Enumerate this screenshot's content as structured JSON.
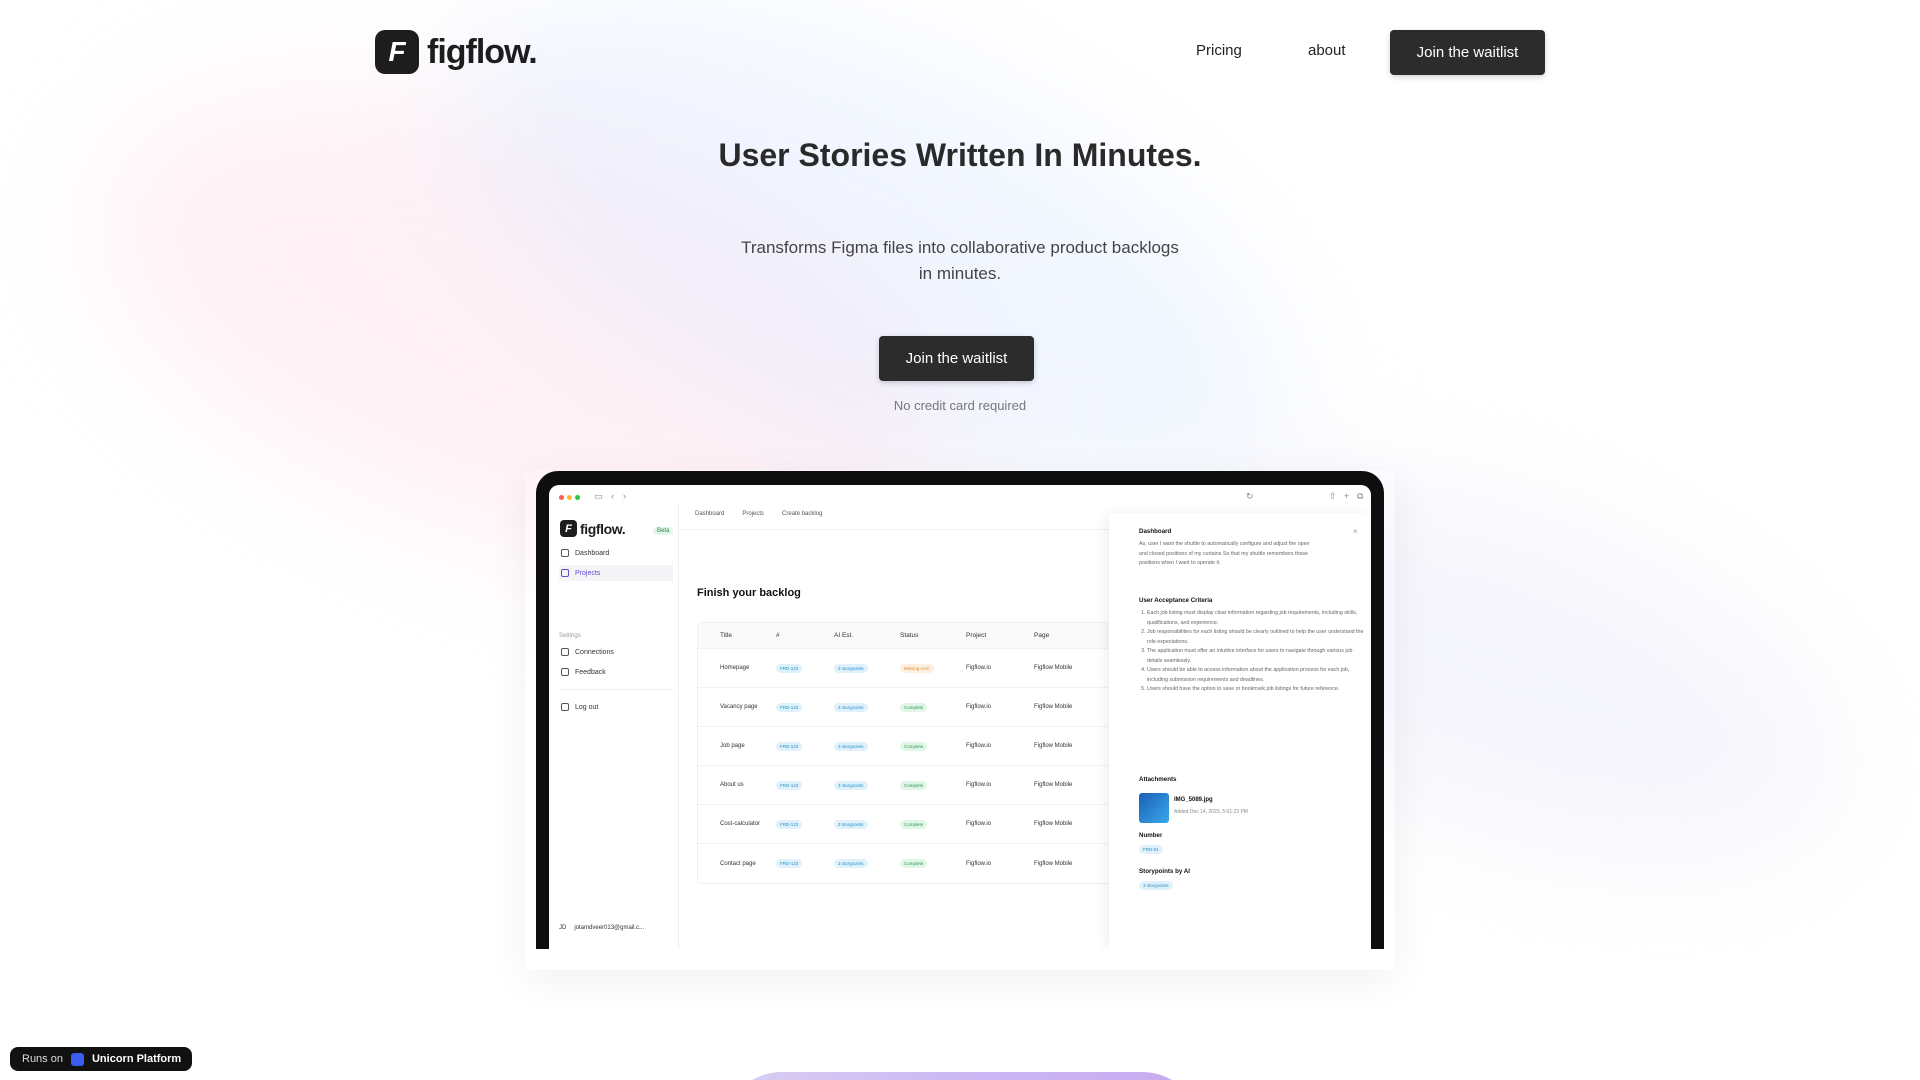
{
  "nav": {
    "logo_text": "figflow.",
    "logo_letter": "F",
    "links": [
      "Pricing",
      "about"
    ],
    "cta": "Join the waitlist"
  },
  "hero": {
    "title": "User Stories Written In Minutes.",
    "subtitle": "Transforms Figma files into collaborative product backlogs in minutes.",
    "cta": "Join the waitlist",
    "note": "No credit card required"
  },
  "mockup": {
    "logo_text": "figflow.",
    "beta": "Beta",
    "sidebar": {
      "items": [
        "Dashboard",
        "Projects"
      ],
      "settings_label": "Settings",
      "settings_items": [
        "Connections",
        "Feedback"
      ],
      "logout": "Log out",
      "user_initials": "JD",
      "user_email": "jotamdveer013@gmail.c..."
    },
    "breadcrumbs": [
      "Dashboard",
      "Projects",
      "Create backlog"
    ],
    "heading": "Finish your backlog",
    "table": {
      "headers": [
        "Title",
        "#",
        "AI Est.",
        "Status",
        "Project",
        "Page"
      ],
      "rows": [
        {
          "title": "Homepage",
          "id": "FRD-123",
          "est": "3 storypoints",
          "status": "Missing UAC",
          "status_kind": "orange",
          "project": "Figflow.io",
          "page": "Figflow Mobile"
        },
        {
          "title": "Vacancy page",
          "id": "FRD-123",
          "est": "3 storypoints",
          "status": "Complete",
          "status_kind": "green",
          "project": "Figflow.io",
          "page": "Figflow Mobile"
        },
        {
          "title": "Job page",
          "id": "FRD-123",
          "est": "3 storypoints",
          "status": "Complete",
          "status_kind": "green",
          "project": "Figflow.io",
          "page": "Figflow Mobile"
        },
        {
          "title": "About us",
          "id": "FRD-123",
          "est": "3 storypoints",
          "status": "Complete",
          "status_kind": "green",
          "project": "Figflow.io",
          "page": "Figflow Mobile"
        },
        {
          "title": "Cost-calculator",
          "id": "FRD-123",
          "est": "3 storypoints",
          "status": "Complete",
          "status_kind": "green",
          "project": "Figflow.io",
          "page": "Figflow Mobile"
        },
        {
          "title": "Contact page",
          "id": "FRD-123",
          "est": "3 storypoints",
          "status": "Complete",
          "status_kind": "green",
          "project": "Figflow.io",
          "page": "Figflow Mobile"
        }
      ]
    },
    "panel": {
      "title": "Dashboard",
      "story": "As, user I want the shuttle to automatically configure and adjust the open and closed positions of my curtains So that my shuttle remembers these positions when I want to operate it.",
      "uac_heading": "User Acceptance Criteria",
      "uac": [
        "Each job listing must display clear information regarding job requirements, including skills, qualifications, and experience.",
        "Job responsibilities for each listing should be clearly outlined to help the user understand the role expectations.",
        "The application must offer an intuitive interface for users to navigate through various job details seamlessly.",
        "Users should be able to access information about the application process for each job, including submission requirements and deadlines.",
        "Users should have the option to save or bookmark job listings for future reference."
      ],
      "attachments_heading": "Attachments",
      "attachment_name": "IMG_5089.jpg",
      "attachment_date": "Added Dec 14, 2023, 5:01:23 PM",
      "number_heading": "Number",
      "number_value": "FRD-01",
      "sp_heading": "Storypoints by AI",
      "sp_value": "3 storypoints"
    }
  },
  "badge": {
    "runs_on": "Runs on",
    "brand": "Unicorn Platform"
  },
  "colors": {
    "primary_dark": "#2c2c2c",
    "accent_purple": "#5b4bd6"
  }
}
